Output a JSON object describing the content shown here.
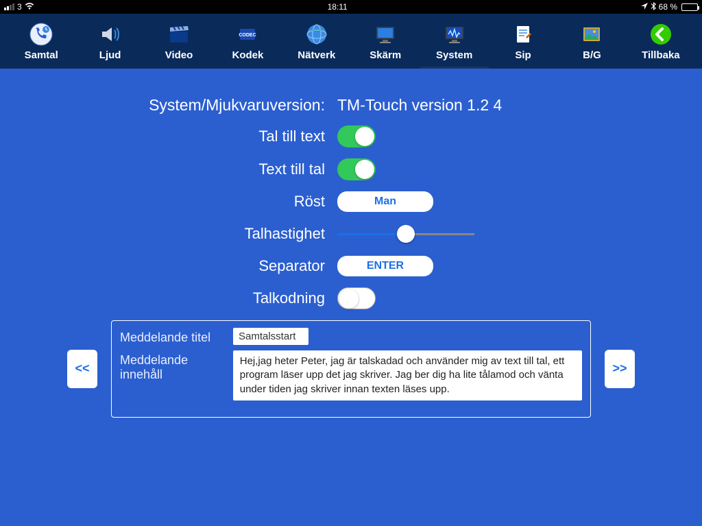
{
  "status": {
    "carrier": "3",
    "time": "18:11",
    "battery_text": "68 %"
  },
  "nav": {
    "items": [
      {
        "label": "Samtal"
      },
      {
        "label": "Ljud"
      },
      {
        "label": "Video"
      },
      {
        "label": "Kodek"
      },
      {
        "label": "Nätverk"
      },
      {
        "label": "Skärm"
      },
      {
        "label": "System"
      },
      {
        "label": "Sip"
      },
      {
        "label": "B/G"
      },
      {
        "label": "Tillbaka"
      }
    ]
  },
  "settings": {
    "version_label": "System/Mjukvaruversion:",
    "version_value": "TM-Touch version 1.2 4",
    "tal_till_text_label": "Tal till text",
    "text_till_tal_label": "Text till tal",
    "rost_label": "Röst",
    "rost_value": "Man",
    "talhastighet_label": "Talhastighet",
    "separator_label": "Separator",
    "separator_value": "ENTER",
    "talkodning_label": "Talkodning"
  },
  "message": {
    "title_label": "Meddelande titel",
    "title_value": "Samtalsstart",
    "content_label": "Meddelande innehåll",
    "content_value": "Hej,jag heter Peter, jag är talskadad och använder mig av text till tal, ett program läser upp det jag skriver. Jag ber dig ha lite tålamod och vänta under tiden jag skriver innan texten läses upp.",
    "prev": "<<",
    "next": ">>"
  }
}
